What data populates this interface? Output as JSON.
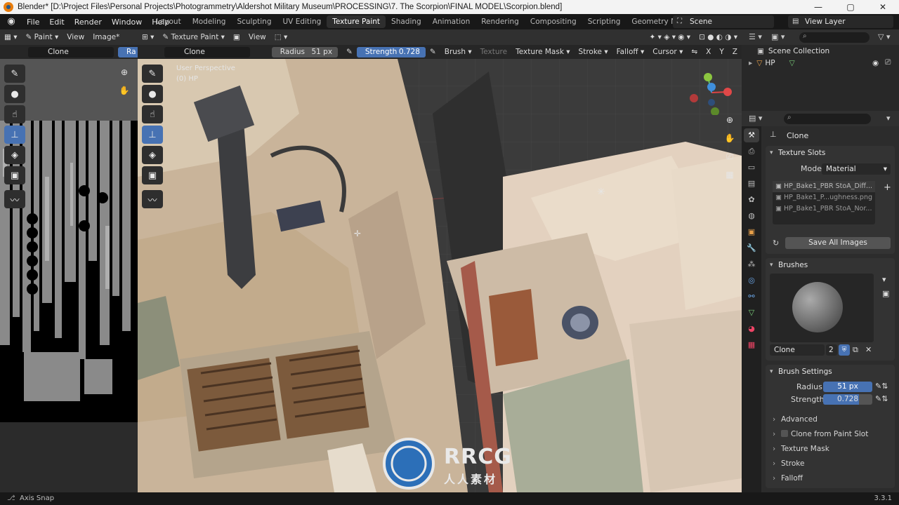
{
  "window": {
    "title": "Blender* [D:\\Project Files\\Personal Projects\\Photogrammetry\\Aldershot Military Museum\\PROCESSING\\7. The Scorpion\\FINAL MODEL\\Scorpion.blend]",
    "minimize": "—",
    "maximize": "▢",
    "close": "✕"
  },
  "menu": [
    "File",
    "Edit",
    "Render",
    "Window",
    "Help"
  ],
  "workspaces": [
    "Layout",
    "Modeling",
    "Sculpting",
    "UV Editing",
    "Texture Paint",
    "Shading",
    "Animation",
    "Rendering",
    "Compositing",
    "Scripting",
    "Geometry Nodes"
  ],
  "active_workspace": "Texture Paint",
  "add_workspace": "+",
  "scene": "Scene",
  "view_layer": "View Layer",
  "image_editor": {
    "mode": "Paint",
    "menus": [
      "View",
      "Image*"
    ],
    "tool_name": "Clone",
    "tool_cut": "Ra"
  },
  "viewport": {
    "mode": "Texture Paint",
    "menu_view": "View",
    "tool_name": "Clone",
    "radius_label": "Radius",
    "radius_value": "51 px",
    "strength_label": "Strength",
    "strength_value": "0.728",
    "strength_fraction": 0.728,
    "tool_items": [
      "Brush",
      "Texture",
      "Texture Mask",
      "Stroke",
      "Falloff",
      "Cursor"
    ],
    "axes": [
      "X",
      "Y",
      "Z"
    ],
    "perspective": "User Perspective",
    "object": "(0) HP"
  },
  "outliner": {
    "collection": "Scene Collection",
    "object": "HP"
  },
  "properties": {
    "brush_name_top": "Clone",
    "texture_slots": {
      "title": "Texture Slots",
      "mode_label": "Mode",
      "mode_value": "Material",
      "slots": [
        "HP_Bake1_PBR StoA_Diff...",
        "HP_Bake1_P...ughness.png",
        "HP_Bake1_PBR StoA_Nor..."
      ],
      "save_button": "Save All Images"
    },
    "brushes": {
      "title": "Brushes",
      "brush_name": "Clone",
      "users": "2"
    },
    "brush_settings": {
      "title": "Brush Settings",
      "radius_label": "Radius",
      "radius_value": "51 px",
      "strength_label": "Strength",
      "strength_value": "0.728"
    },
    "subpanels": [
      "Advanced",
      "Clone from Paint Slot",
      "Texture Mask",
      "Stroke",
      "Falloff"
    ]
  },
  "status": {
    "left": "Axis Snap",
    "version": "3.3.1"
  },
  "watermark": {
    "big": "RRCG",
    "small": "人人素材"
  }
}
